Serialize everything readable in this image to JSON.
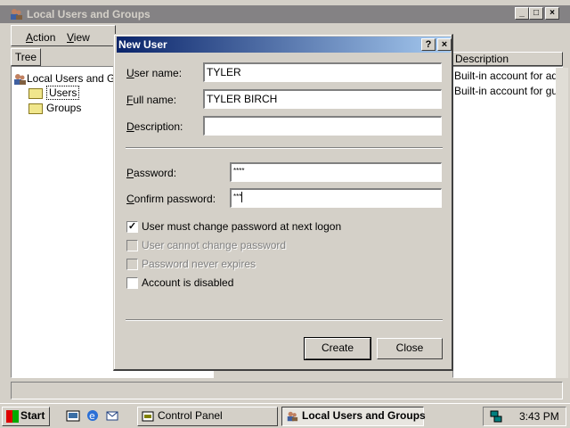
{
  "mmc": {
    "title": "Local Users and Groups",
    "menu": {
      "action": "Action",
      "view": "View"
    },
    "tree_tab": "Tree",
    "tree": {
      "root": "Local Users and Groups",
      "users": "Users",
      "groups": "Groups"
    },
    "list": {
      "column_header": "Description",
      "rows": [
        "Built-in account for administering the computer/domain",
        "Built-in account for guest access"
      ]
    }
  },
  "dialog": {
    "title": "New User",
    "username_label": "User name:",
    "username_value": "TYLER",
    "fullname_label": "Full name:",
    "fullname_value": "TYLER BIRCH",
    "description_label": "Description:",
    "description_value": "",
    "password_label": "Password:",
    "password_value": "****",
    "confirm_label": "Confirm password:",
    "confirm_value": "***",
    "checkboxes": [
      {
        "label": "User must change password at next logon",
        "checked": true,
        "enabled": true
      },
      {
        "label": "User cannot change password",
        "checked": false,
        "enabled": false
      },
      {
        "label": "Password never expires",
        "checked": false,
        "enabled": false
      },
      {
        "label": "Account is disabled",
        "checked": false,
        "enabled": true
      }
    ],
    "create_label": "Create",
    "close_label": "Close"
  },
  "taskbar": {
    "start_label": "Start",
    "tasks": [
      "Control Panel",
      "Local Users and Groups"
    ],
    "clock": "3:43 PM"
  },
  "colors": {
    "desktop": "#3a6ea5",
    "face": "#d4d0c8",
    "active_title_start": "#0a246a",
    "active_title_end": "#a6caf0",
    "inactive_title": "#848284"
  }
}
